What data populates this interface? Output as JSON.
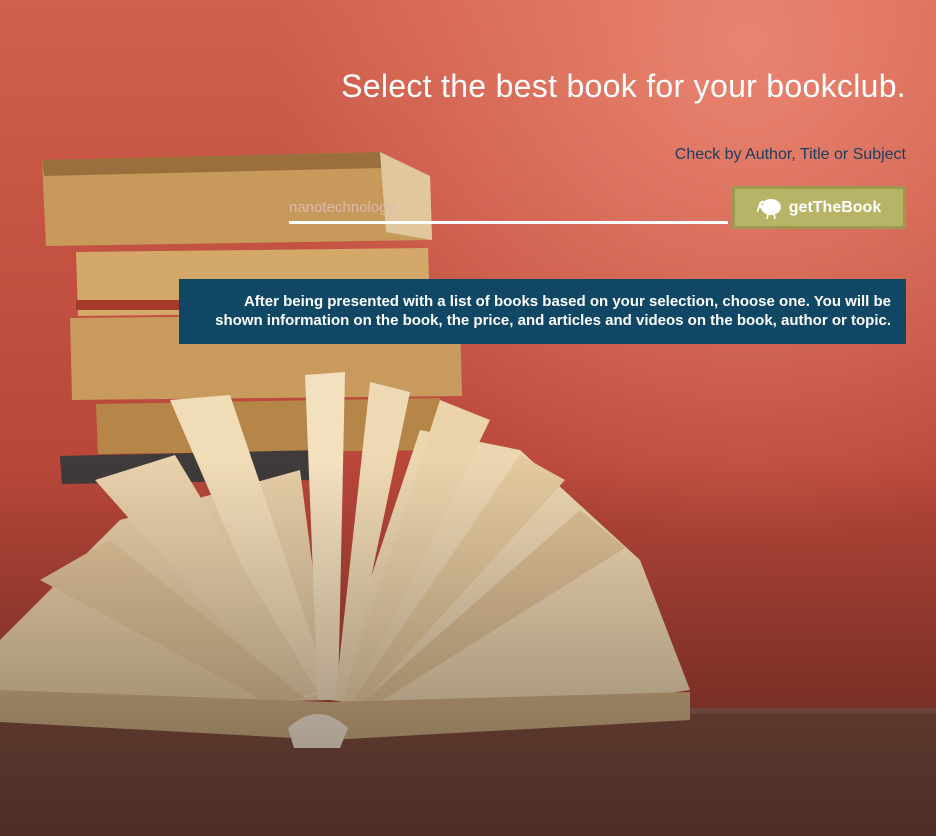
{
  "page": {
    "headline": "Select the best book for your bookclub.",
    "subheading": "Check by Author, Title or Subject"
  },
  "search": {
    "placeholder": "nanotechnology",
    "value": ""
  },
  "button": {
    "label": "getTheBook",
    "icon": "kiwi-bird-icon"
  },
  "info": {
    "text": "After being presented with a list of books based on your selection, choose one. You will be shown information on the book, the price, and articles and videos on the book, author or topic."
  },
  "colors": {
    "background": "#c0513f",
    "headline": "#ffffff",
    "subheading": "#1b3e5e",
    "button": "#b7b468",
    "info_box": "#0f4764"
  }
}
